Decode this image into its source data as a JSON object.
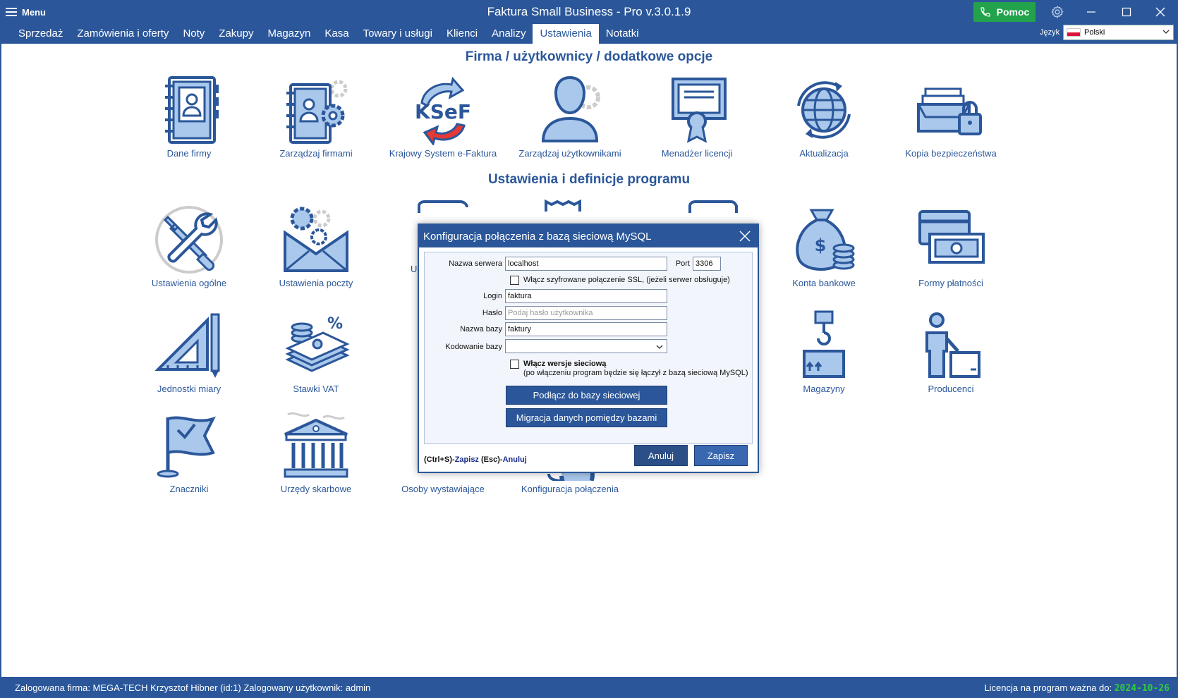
{
  "titlebar": {
    "menu_label": "Menu",
    "app_title": "Faktura Small Business - Pro v.3.0.1.9",
    "help_label": "Pomoc"
  },
  "tabs": [
    {
      "label": "Sprzedaż"
    },
    {
      "label": "Zamówienia i oferty"
    },
    {
      "label": "Noty"
    },
    {
      "label": "Zakupy"
    },
    {
      "label": "Magazyn"
    },
    {
      "label": "Kasa"
    },
    {
      "label": "Towary i usługi"
    },
    {
      "label": "Klienci"
    },
    {
      "label": "Analizy"
    },
    {
      "label": "Ustawienia",
      "active": true
    },
    {
      "label": "Notatki"
    }
  ],
  "language": {
    "label": "Język",
    "value": "Polski"
  },
  "section1": {
    "title": "Firma / użytkownicy / dodatkowe opcje",
    "tiles": [
      {
        "label": "Dane firmy",
        "icon": "address-book-icon"
      },
      {
        "label": "Zarządzaj firmami",
        "icon": "address-book-gear-icon"
      },
      {
        "label": "Krajowy System e-Faktura",
        "icon": "ksef-logo-icon"
      },
      {
        "label": "Zarządzaj użytkownikami",
        "icon": "user-gear-icon"
      },
      {
        "label": "Menadżer licencji",
        "icon": "certificate-icon"
      },
      {
        "label": "Aktualizacja",
        "icon": "globe-refresh-icon"
      },
      {
        "label": "Kopia bezpieczeństwa",
        "icon": "archive-lock-icon"
      }
    ]
  },
  "section2": {
    "title": "Ustawienia i definicje programu",
    "tiles": [
      {
        "label": "Ustawienia ogólne",
        "icon": "tools-icon"
      },
      {
        "label": "Ustawienia poczty",
        "icon": "mail-gear-icon"
      },
      {
        "label": "Konta bankowe",
        "icon": "money-bag-icon"
      },
      {
        "label": "Formy płatności",
        "icon": "payment-cards-icon"
      },
      {
        "label": "Jednostki miary",
        "icon": "ruler-triangle-icon"
      },
      {
        "label": "Stawki VAT",
        "icon": "vat-money-icon"
      },
      {
        "label": "Magazyny",
        "icon": "warehouse-crane-icon"
      },
      {
        "label": "Producenci",
        "icon": "producer-icon"
      },
      {
        "label": "Znaczniki",
        "icon": "flag-icon"
      },
      {
        "label": "Urzędy skarbowe",
        "icon": "tax-office-icon"
      },
      {
        "label": "Osoby wystawiające",
        "icon": "issuer-icon"
      },
      {
        "label": "Konfiguracja połączenia",
        "icon": "connection-gear-icon"
      }
    ]
  },
  "dialog": {
    "title": "Konfiguracja połączenia z bazą sieciową MySQL",
    "server_label": "Nazwa serwera",
    "server_value": "localhost",
    "port_label": "Port",
    "port_value": "3306",
    "ssl_label": "Włącz szyfrowane połączenie SSL, (jeżeli serwer obsługuje)",
    "ssl_checked": false,
    "login_label": "Login",
    "login_value": "faktura",
    "password_label": "Hasło",
    "password_placeholder": "Podaj hasło użytkownika",
    "db_label": "Nazwa bazy",
    "db_value": "faktury",
    "encoding_label": "Kodowanie bazy",
    "encoding_value": "",
    "network_label": "Włącz wersje sieciową",
    "network_note": "(po włączeniu program będzie się łączył z bazą sieciową MySQL)",
    "network_checked": false,
    "connect_button": "Podłącz do bazy sieciowej",
    "migrate_button": "Migracja danych pomiędzy bazami",
    "hint_save_key": "(Ctrl+S)-",
    "hint_save": "Zapisz",
    "hint_cancel_key": " (Esc)-",
    "hint_cancel": "Anuluj",
    "cancel_button": "Anuluj",
    "save_button": "Zapisz"
  },
  "status": {
    "left": "Zalogowana firma: MEGA-TECH Krzysztof Hibner (id:1) Zalogowany użytkownik: admin",
    "right_label": "Licencja na program ważna do: ",
    "license_date": "2024-10-26"
  },
  "colors": {
    "primary": "#2b579a",
    "help_green": "#22a34b",
    "license_green": "#2ecc40",
    "icon_fill": "#a9c8ec"
  }
}
